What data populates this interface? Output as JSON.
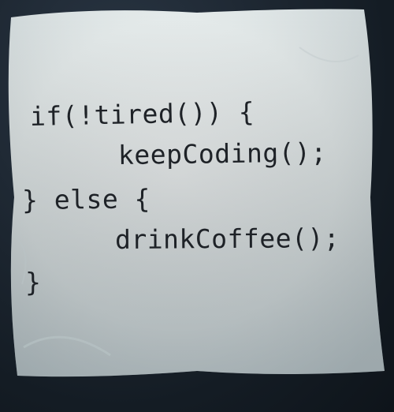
{
  "pillow": {
    "code_lines": [
      "if(!tired()) {",
      "keepCoding();",
      "} else {",
      "drinkCoffee();",
      "}"
    ]
  },
  "colors": {
    "background": "#1b2530",
    "pillow_fabric": "#e9eeee",
    "print_ink": "#1e2227"
  }
}
